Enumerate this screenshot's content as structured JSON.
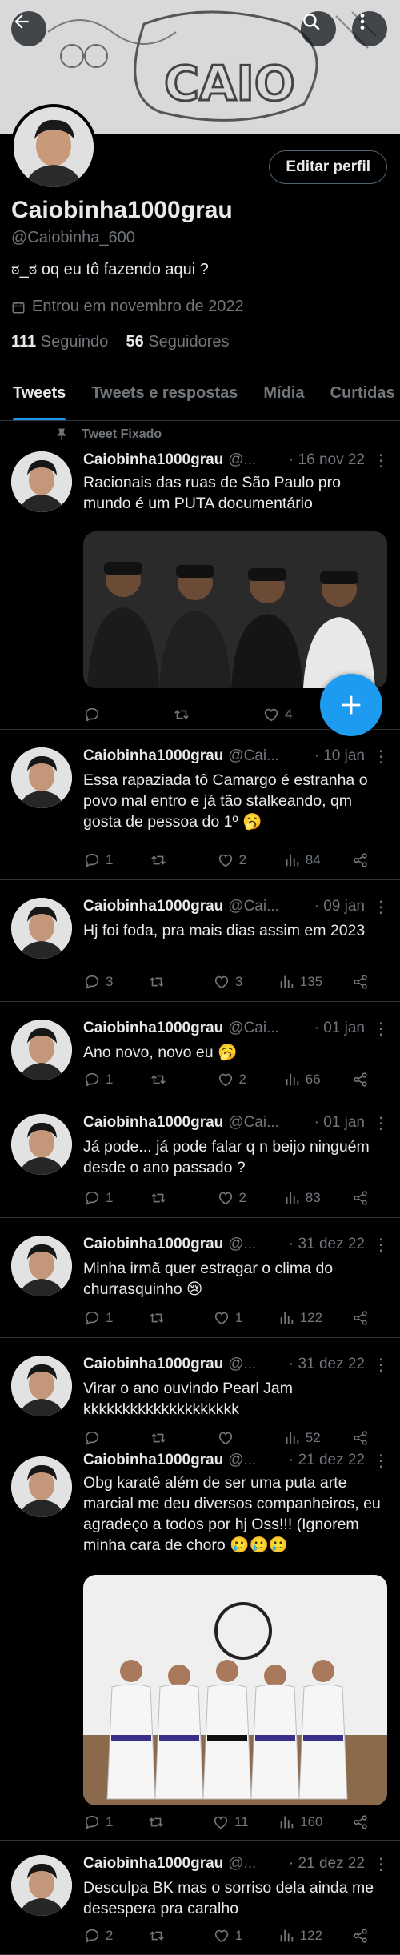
{
  "header": {
    "back_icon": "arrow-left-icon",
    "search_icon": "search-icon",
    "more_icon": "more-vertical-icon",
    "banner_text": "CAIO"
  },
  "profile": {
    "name": "Caiobinha1000grau",
    "handle": "@Caiobinha_600",
    "bio": "ಠ_ಠ oq eu tô fazendo aqui ?",
    "joined": "Entrou em novembro de 2022",
    "following_count": "111",
    "following_label": "Seguindo",
    "followers_count": "56",
    "followers_label": "Seguidores",
    "edit_label": "Editar perfil"
  },
  "tabs": [
    "Tweets",
    "Tweets e respostas",
    "Mídia",
    "Curtidas"
  ],
  "pinned_label": "Tweet Fixado",
  "tweets": [
    {
      "name": "Caiobinha1000grau",
      "handle": "@...",
      "date": "· 16 nov 22",
      "text": "Racionais das ruas de São Paulo pro mundo é um PUTA documentário",
      "replies": "",
      "retweets": "",
      "likes": "4",
      "views": "",
      "has_share": false
    },
    {
      "name": "Caiobinha1000grau",
      "handle": "@Cai...",
      "date": "· 10 jan",
      "text": "Essa rapaziada tô Camargo é estranha o povo mal entro e já tão stalkeando, qm gosta de pessoa do 1º 🥱",
      "replies": "1",
      "retweets": "",
      "likes": "2",
      "views": "84",
      "has_share": true
    },
    {
      "name": "Caiobinha1000grau",
      "handle": "@Cai...",
      "date": "· 09 jan",
      "text": "Hj foi foda, pra mais dias assim em 2023",
      "replies": "3",
      "retweets": "",
      "likes": "3",
      "views": "135",
      "has_share": true
    },
    {
      "name": "Caiobinha1000grau",
      "handle": "@Cai...",
      "date": "· 01 jan",
      "text": "Ano novo, novo eu 🥱",
      "replies": "1",
      "retweets": "",
      "likes": "2",
      "views": "66",
      "has_share": true
    },
    {
      "name": "Caiobinha1000grau",
      "handle": "@Cai...",
      "date": "· 01 jan",
      "text": "Já pode... já pode falar q n beijo ninguém desde o ano passado ?",
      "replies": "1",
      "retweets": "",
      "likes": "2",
      "views": "83",
      "has_share": true
    },
    {
      "name": "Caiobinha1000grau",
      "handle": "@...",
      "date": "· 31 dez 22",
      "text": "Minha irmã quer estragar o clima do churrasquinho 😢",
      "replies": "1",
      "retweets": "",
      "likes": "1",
      "views": "122",
      "has_share": true
    },
    {
      "name": "Caiobinha1000grau",
      "handle": "@...",
      "date": "· 31 dez 22",
      "text": "Virar o ano ouvindo Pearl Jam kkkkkkkkkkkkkkkkkkkk",
      "replies": "",
      "retweets": "",
      "likes": "",
      "views": "52",
      "has_share": true
    },
    {
      "name": "Caiobinha1000grau",
      "handle": "@...",
      "date": "· 21 dez 22",
      "text": "Obg karatê além de ser uma puta arte marcial me deu diversos companheiros, eu agradeço a todos por hj Oss!!! (Ignorem minha cara de choro 🥲🥲🥲",
      "replies": "1",
      "retweets": "",
      "likes": "11",
      "views": "160",
      "has_share": true
    },
    {
      "name": "Caiobinha1000grau",
      "handle": "@...",
      "date": "· 21 dez 22",
      "text": "Desculpa BK mas o sorriso dela ainda me desespera pra caralho",
      "replies": "2",
      "retweets": "",
      "likes": "1",
      "views": "122",
      "has_share": true
    }
  ],
  "fab_icon": "plus-icon",
  "colors": {
    "accent": "#1d9bf0",
    "muted": "#71767b",
    "background": "#000000",
    "text": "#e7e9ea"
  }
}
